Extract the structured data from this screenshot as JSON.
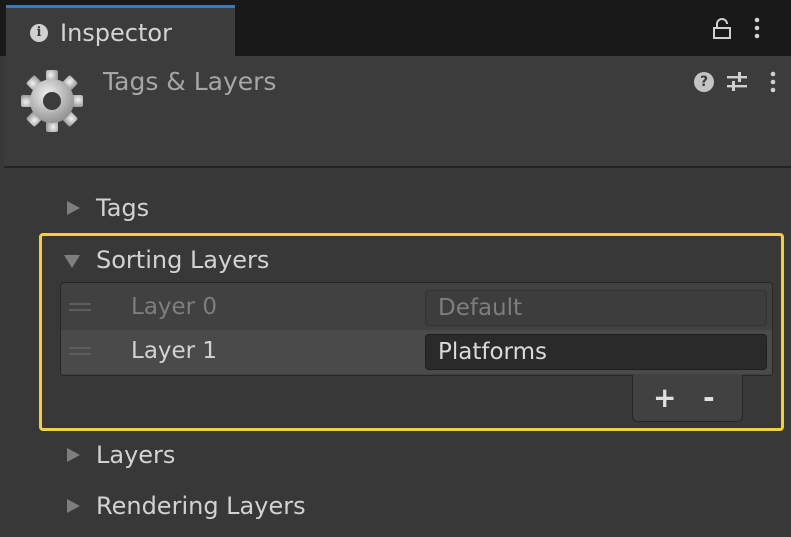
{
  "tab": {
    "label": "Inspector",
    "icon": "info-icon"
  },
  "header": {
    "title": "Tags & Layers",
    "icons": [
      "gear-icon",
      "help-icon",
      "presets-icon",
      "menu-icon"
    ]
  },
  "foldouts": {
    "tags": "Tags",
    "sorting_layers": "Sorting Layers",
    "layers": "Layers",
    "rendering_layers": "Rendering Layers"
  },
  "sorting_layers": [
    {
      "label": "Layer 0",
      "value": "Default",
      "editable": false
    },
    {
      "label": "Layer 1",
      "value": "Platforms",
      "editable": true
    }
  ],
  "list_footer": {
    "add_label": "+",
    "remove_label": "-"
  },
  "colors": {
    "tab_accent": "#3a79bb",
    "highlight": "#f3cf3e",
    "background": "#383838"
  }
}
